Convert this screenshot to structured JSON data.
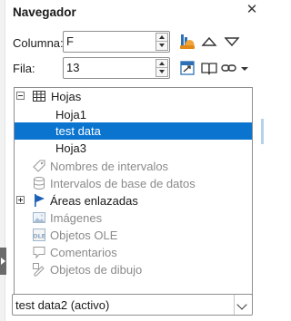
{
  "panel": {
    "title": "Navegador",
    "close_glyph": "✕"
  },
  "column": {
    "label": "Columna:",
    "value": "F"
  },
  "row": {
    "label": "Fila:",
    "value": "13"
  },
  "toolbar_icons": [
    "data-range-icon",
    "navigate-up-icon",
    "navigate-down-icon",
    "toggle-content-icon",
    "scenarios-icon",
    "insert-mode-link-icon",
    "dropdown-arrow-icon"
  ],
  "tree": {
    "sheets": {
      "label": "Hojas",
      "children": [
        "Hoja1",
        "test data",
        "Hoja3"
      ],
      "selected_index": 1
    },
    "items": [
      {
        "label": "Nombres de intervalos",
        "icon": "range-names-icon",
        "enabled": false
      },
      {
        "label": "Intervalos de base de datos",
        "icon": "database-icon",
        "enabled": false
      },
      {
        "label": "Áreas enlazadas",
        "icon": "linked-areas-flag-icon",
        "enabled": true
      },
      {
        "label": "Imágenes",
        "icon": "images-icon",
        "enabled": false
      },
      {
        "label": "Objetos OLE",
        "icon": "ole-object-icon",
        "enabled": false
      },
      {
        "label": "Comentarios",
        "icon": "comments-icon",
        "enabled": false
      },
      {
        "label": "Objetos de dibujo",
        "icon": "drawing-objects-icon",
        "enabled": false
      }
    ]
  },
  "document_select": {
    "value": "test data2 (activo)"
  },
  "colors": {
    "selection": "#0a74cf",
    "flag_blue": "#1a5fb4",
    "disabled_text": "#8a8a8a"
  }
}
